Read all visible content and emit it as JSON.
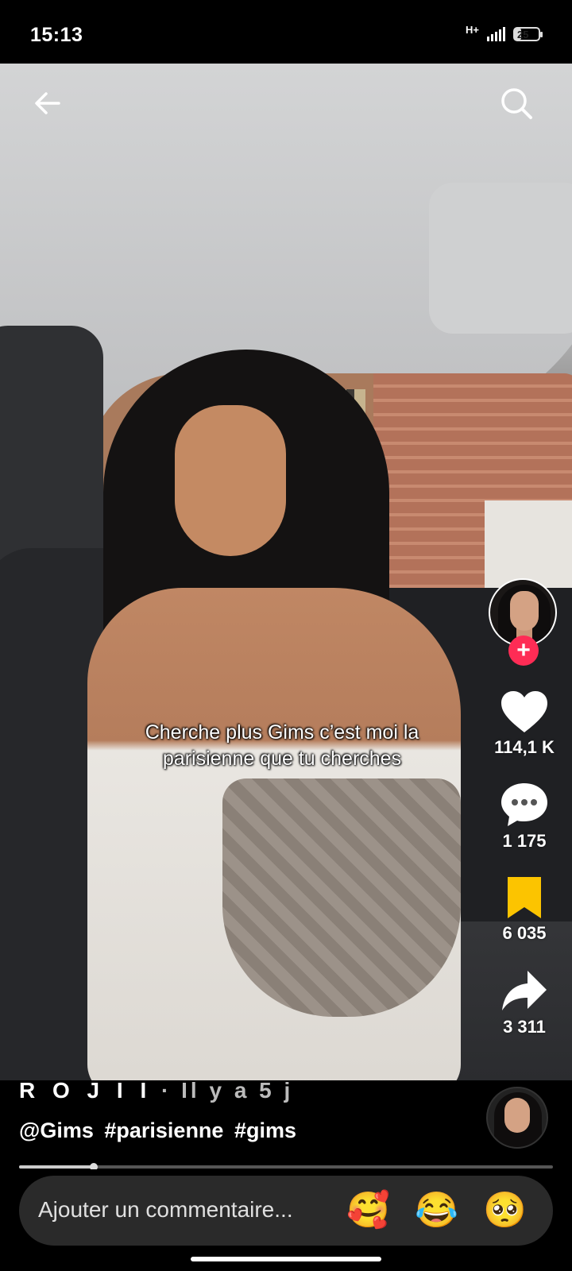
{
  "status_bar": {
    "time": "15:13",
    "network": "H+",
    "battery": "25",
    "battery_level": 0.25
  },
  "video": {
    "caption_line1": "Cherche plus Gims c’est moi la",
    "caption_line2": "parisienne que tu cherches"
  },
  "icons": {
    "back": "arrow-left-icon",
    "search": "search-icon",
    "like": "heart-icon",
    "comment": "comment-bubble-icon",
    "save": "bookmark-icon",
    "share": "share-arrow-icon",
    "follow": "plus-icon"
  },
  "actions": {
    "follow_symbol": "+",
    "likes": "114,1 K",
    "comments": "1 175",
    "saves": "6 035",
    "shares": "3 311"
  },
  "post": {
    "author": "R O J I I",
    "separator": " · ",
    "time": "Il y a 5 j",
    "mention": "@Gims",
    "hashtag1": "#parisienne",
    "hashtag2": "#gims"
  },
  "playback": {
    "progress": 0.14
  },
  "comment_bar": {
    "placeholder": "Ajouter un commentaire...",
    "emoji1": "🥰",
    "emoji2": "😂",
    "emoji3": "🥺"
  },
  "colors": {
    "follow_accent": "#fe2c55",
    "bookmark_active": "#fcc400",
    "background": "#000000"
  }
}
